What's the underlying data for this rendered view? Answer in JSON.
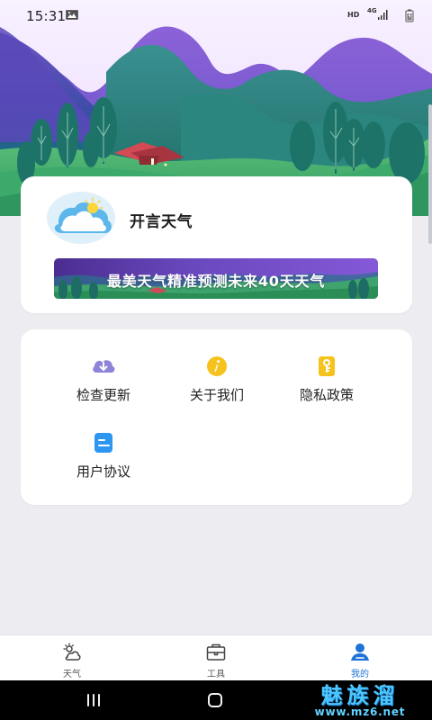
{
  "status_bar": {
    "time": "15:31",
    "network_hd": "HD",
    "network_4g": "4G",
    "icons": [
      "gallery-icon",
      "signal-icon",
      "battery-icon"
    ]
  },
  "profile": {
    "app_name": "开言天气",
    "banner_text": "最美天气精准预测未来40天天气",
    "logo_icon": "cloud-sun-icon"
  },
  "menu": {
    "items": [
      {
        "label": "检查更新",
        "icon": "cloud-download-icon"
      },
      {
        "label": "关于我们",
        "icon": "info-icon"
      },
      {
        "label": "隐私政策",
        "icon": "privacy-key-icon"
      },
      {
        "label": "用户协议",
        "icon": "agreement-icon"
      }
    ]
  },
  "tabbar": {
    "tabs": [
      {
        "label": "天气",
        "icon": "weather-icon",
        "selected": false
      },
      {
        "label": "工具",
        "icon": "toolbox-icon",
        "selected": false
      },
      {
        "label": "我的",
        "icon": "profile-icon",
        "selected": true
      }
    ]
  },
  "system_nav": {
    "icons": [
      "recent-apps-icon",
      "home-icon"
    ]
  },
  "watermark": {
    "title": "魅族溜",
    "url": "www.mz6.net"
  },
  "colors": {
    "background": "#ededf1",
    "card": "#ffffff",
    "accent_blue": "#1f73d7",
    "banner_purple": "#6948bd",
    "hill_purple": "#7058c9",
    "hill_teal": "#2e8c85",
    "grass_green": "#36a86c",
    "info_yellow": "#f6c21d",
    "cloud_lavender": "#8d83d9",
    "agreement_blue": "#2d96f0",
    "navbar_black": "#000000"
  }
}
